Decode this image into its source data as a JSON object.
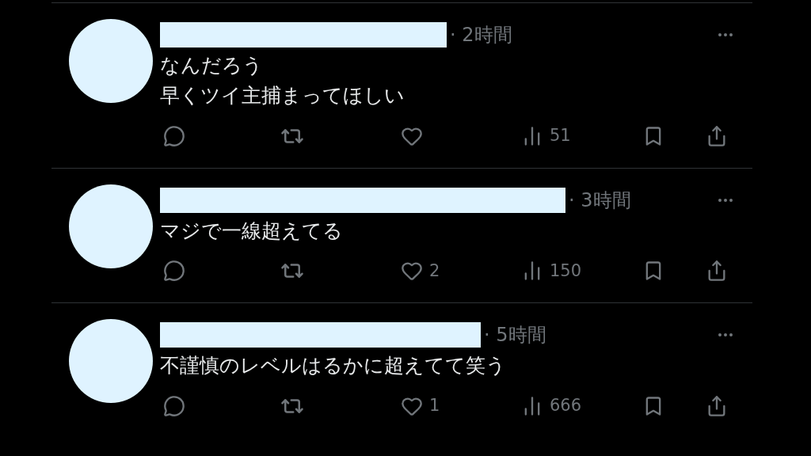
{
  "posts": [
    {
      "time": "· 2時間",
      "lines": [
        "なんだろう",
        "早くツイ主捕まってほしい"
      ],
      "views": "51"
    },
    {
      "time": "· 3時間",
      "lines": [
        "マジで一線超えてる"
      ],
      "likes": "2",
      "views": "150"
    },
    {
      "time": "· 5時間",
      "lines": [
        "不謹慎のレベルはるかに超えてて笑う"
      ],
      "likes": "1",
      "views": "666"
    }
  ]
}
